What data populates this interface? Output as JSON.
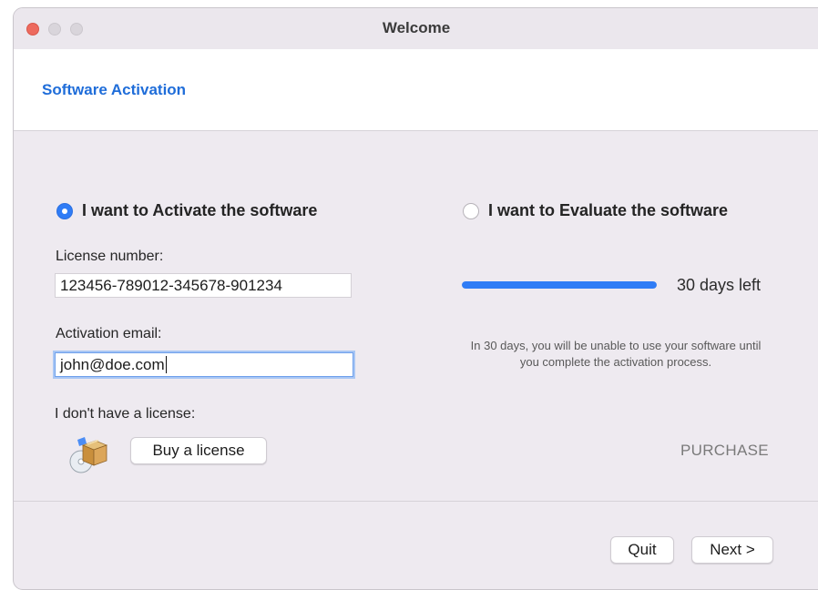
{
  "window": {
    "title": "Welcome"
  },
  "header": {
    "title": "Software Activation"
  },
  "activate": {
    "radio_label": "I want to Activate the software",
    "selected": true,
    "license_label": "License number:",
    "license_value": "123456-789012-345678-901234",
    "email_label": "Activation email:",
    "email_value": "john@doe.com",
    "no_license_label": "I don't have a license:",
    "buy_button": "Buy a license",
    "package_icon": "software-package-icon"
  },
  "evaluate": {
    "radio_label": "I want to Evaluate the software",
    "selected": false,
    "progress_fraction": 1.0,
    "progress_color": "#2f7cf6",
    "days_left": "30 days left",
    "info": "In 30 days, you will be unable to use your software until you complete the activation process.",
    "purchase_link": "PURCHASE"
  },
  "footer": {
    "quit_button": "Quit",
    "next_button": "Next >"
  },
  "colors": {
    "accent": "#2f7cf6",
    "header_title": "#1f6dd9",
    "traffic_close": "#ed6a5e"
  }
}
